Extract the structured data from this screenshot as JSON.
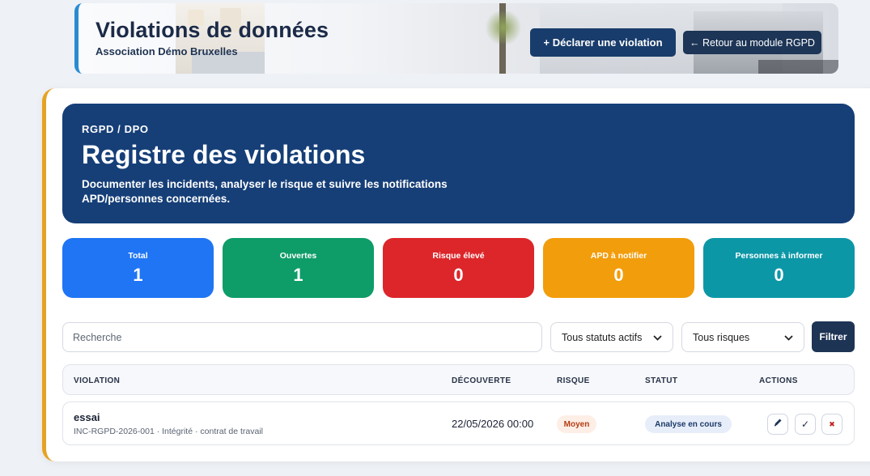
{
  "header": {
    "title": "Violations de données",
    "subtitle": "Association Démo Bruxelles",
    "declare_button": "+ Déclarer une violation",
    "back_button": "← Retour au module RGPD"
  },
  "hero": {
    "kicker": "RGPD / DPO",
    "title": "Registre des violations",
    "description": "Documenter les incidents, analyser le risque et suivre les notifications APD/personnes concernées."
  },
  "stats": [
    {
      "label": "Total",
      "value": "1",
      "color": "#1f75f4"
    },
    {
      "label": "Ouvertes",
      "value": "1",
      "color": "#0e9c69"
    },
    {
      "label": "Risque élevé",
      "value": "0",
      "color": "#dc262a"
    },
    {
      "label": "APD à notifier",
      "value": "0",
      "color": "#f29d0c"
    },
    {
      "label": "Personnes à informer",
      "value": "0",
      "color": "#0c97a7"
    }
  ],
  "filters": {
    "search_placeholder": "Recherche",
    "status_value": "Tous statuts actifs",
    "risk_value": "Tous risques",
    "filter_button": "Filtrer"
  },
  "table": {
    "columns": [
      "VIOLATION",
      "DÉCOUVERTE",
      "RISQUE",
      "STATUT",
      "ACTIONS"
    ],
    "rows": [
      {
        "name": "essai",
        "meta": "INC-RGPD-2026-001 · Intégrité · contrat de travail",
        "date": "22/05/2026 00:00",
        "risk": "Moyen",
        "status": "Analyse en cours"
      }
    ],
    "actions": {
      "check_glyph": "✓",
      "close_glyph": "✖"
    }
  },
  "colors": {
    "primary": "#163f78",
    "accent_border": "#e6a321",
    "header_border": "#2a8bd1"
  }
}
